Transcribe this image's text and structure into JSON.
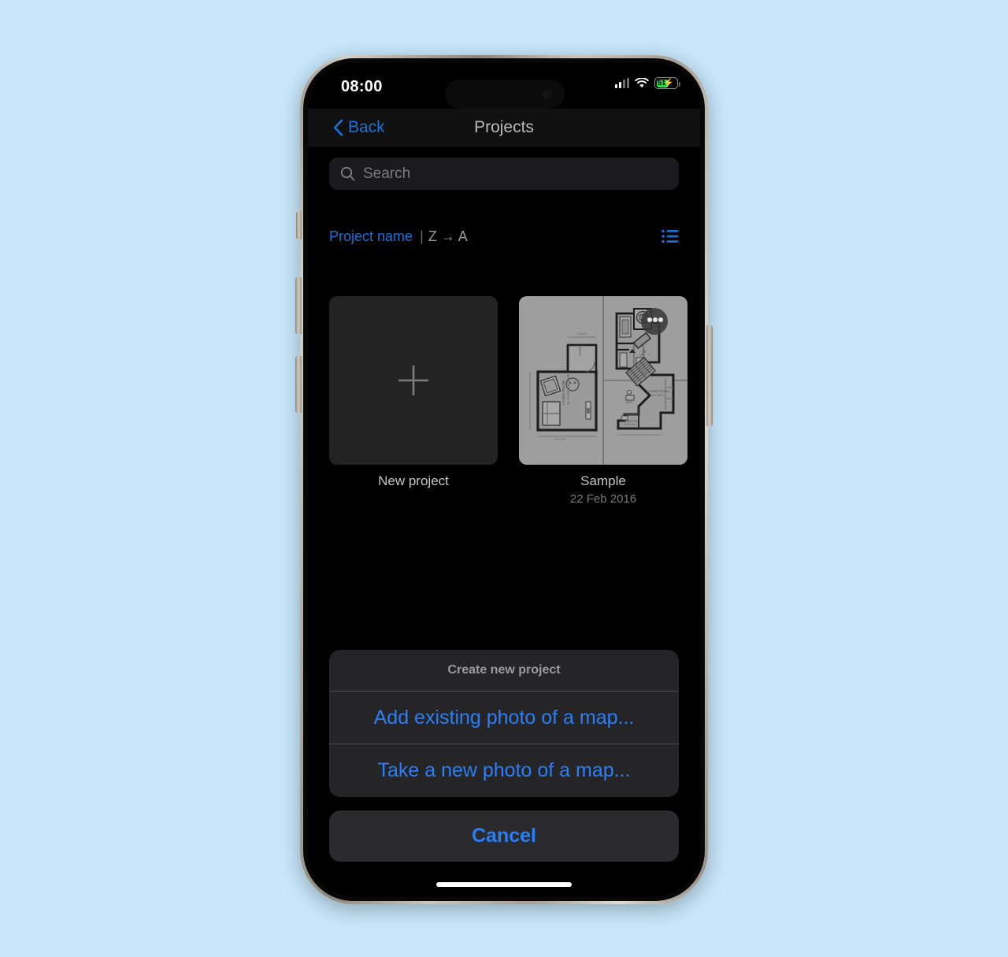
{
  "status_bar": {
    "time": "08:00",
    "battery_level": "51",
    "battery_charging_glyph": "⚡",
    "cellular_icon": "cellular-signal-icon",
    "wifi_icon": "wifi-icon",
    "battery_icon": "battery-icon",
    "battery_color": "#32d74b"
  },
  "nav_bar": {
    "back_label": "Back",
    "back_icon": "chevron-left-icon",
    "title": "Projects",
    "accent_color": "#1573d8"
  },
  "search": {
    "placeholder": "Search",
    "value": "",
    "icon": "search-icon"
  },
  "sort": {
    "field_label": "Project name",
    "separator": "|",
    "direction_label": "Z → A",
    "view_toggle_icon": "list-view-icon"
  },
  "projects": [
    {
      "name": "New project",
      "date": "",
      "thumb_type": "plus-placeholder",
      "icon": "plus-icon"
    },
    {
      "name": "Sample",
      "date": "22 Feb 2016",
      "thumb_type": "floor-plan-image",
      "icon": "floorplan-thumbnail"
    }
  ],
  "action_sheet": {
    "title": "Create new project",
    "actions": [
      {
        "label": "Add existing photo of a map..."
      },
      {
        "label": "Take a new photo of a map..."
      }
    ],
    "cancel_label": "Cancel",
    "accent_color": "#2b7ff5"
  }
}
